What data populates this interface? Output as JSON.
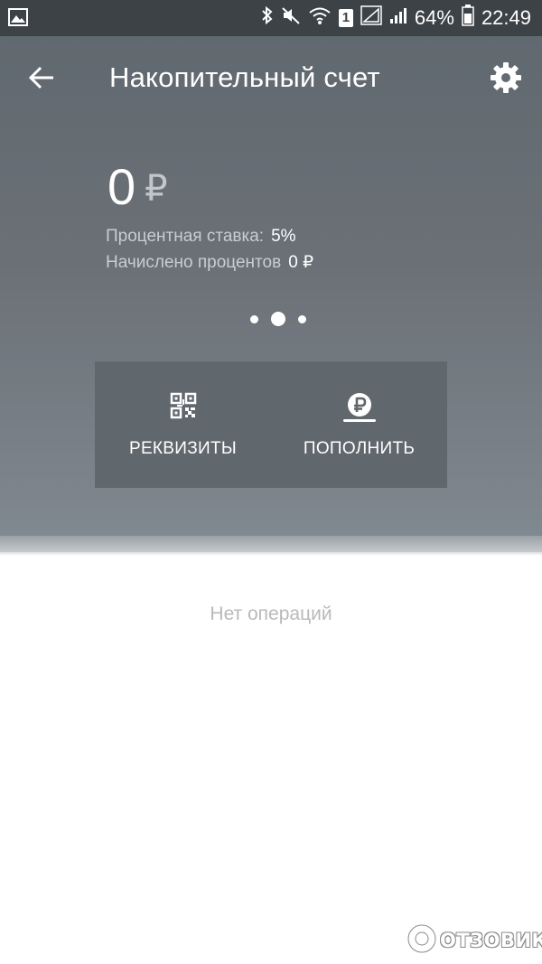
{
  "status_bar": {
    "battery": "64%",
    "time": "22:49",
    "sim_number": "1",
    "icons": [
      "gallery-icon",
      "bluetooth-icon",
      "mute-icon",
      "wifi-icon",
      "sim-icon",
      "signal-icon",
      "signal-icon",
      "battery-icon"
    ]
  },
  "header": {
    "title": "Накопительный счет",
    "back_icon": "arrow-left-icon",
    "settings_icon": "gear-icon"
  },
  "account": {
    "balance": "0",
    "currency": "₽",
    "rate_label": "Процентная ставка:",
    "rate_value": "5%",
    "accrued_label": "Начислено процентов",
    "accrued_value": "0 ₽"
  },
  "pager": {
    "count": 3,
    "active_index": 1
  },
  "actions": {
    "details_label": "РЕКВИЗИТЫ",
    "details_icon": "qr-code-icon",
    "topup_label": "ПОПОЛНИТЬ",
    "topup_icon": "ruble-coin-icon"
  },
  "operations": {
    "empty_text": "Нет операций"
  },
  "watermark": {
    "text": "ОТЗОВИК"
  },
  "colors": {
    "status_bar": "#3d4247",
    "header": "#6a7076",
    "action_panel": "#60676d",
    "empty_text": "#b9b9b9"
  }
}
